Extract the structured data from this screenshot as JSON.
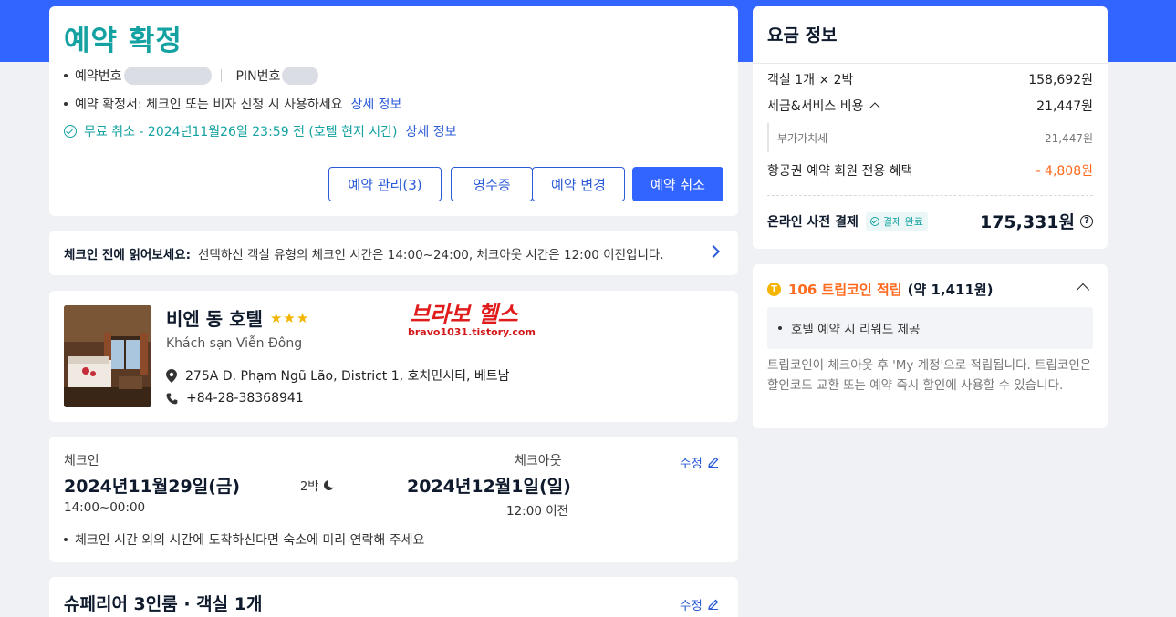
{
  "header": {
    "title": "예약 확정",
    "booking_number_label": "예약번호",
    "pin_label": "PIN번호",
    "confirmation_text": "예약 확정서: 체크인 또는 비자 신청 시 사용하세요",
    "confirmation_link": "상세 정보",
    "free_cancel_text": "무료 취소 - 2024년11월26일 23:59 전 (호텔 현지 시간)",
    "free_cancel_link": "상세 정보",
    "buttons": {
      "manage": "예약 관리(3)",
      "receipt": "영수증",
      "change": "예약 변경",
      "cancel": "예약 취소"
    }
  },
  "notice": {
    "label": "체크인 전에 읽어보세요:",
    "text": "선택하신 객실 유형의 체크인 시간은 14:00~24:00, 체크아웃 시간은 12:00 이전입니다."
  },
  "hotel": {
    "name": "비엔 동 호텔",
    "stars": "★★★",
    "star_count": 3,
    "local_name": "Khách sạn Viễn Đông",
    "address": "275A Đ. Phạm Ngũ Lão, District 1, 호치민시티, 베트남",
    "phone": "+84-28-38368941",
    "watermark_title": "브라보 헬스",
    "watermark_url": "bravo1031.tistory.com"
  },
  "stay": {
    "checkin_label": "체크인",
    "checkin_date": "2024년11월29일(금)",
    "checkin_time": "14:00~00:00",
    "nights": "2박",
    "checkout_label": "체크아웃",
    "checkout_date": "2024년12월1일(일)",
    "checkout_time": "12:00 이전",
    "edit_label": "수정",
    "note": "체크인 시간 외의 시간에 도착하신다면 숙소에 미리 연락해 주세요"
  },
  "room": {
    "title": "슈페리어 3인룸 · 객실 1개",
    "edit_label": "수정"
  },
  "price": {
    "title": "요금 정보",
    "rows": [
      {
        "label": "객실 1개 × 2박",
        "value": "158,692원"
      },
      {
        "label": "세금&서비스 비용",
        "value": "21,447원"
      },
      {
        "label": "부가가치세",
        "value": "21,447원"
      },
      {
        "label": "항공권 예약 회원 전용 혜택",
        "value": "- 4,808원"
      }
    ],
    "total_label": "온라인 사전 결제",
    "paid_badge": "결제 완료",
    "total_value": "175,331원",
    "accent_color": "#ff6a1f"
  },
  "coin": {
    "amount": "106 트립코인 적립",
    "approx": "(약 1,411원)",
    "reward_item": "호텔 예약 시 리워드 제공",
    "description": "트립코인이 체크아웃 후 'My 계정'으로 적립됩니다. 트립코인은 할인코드 교환 또는 예약 즉시 할인에 사용할 수 있습니다."
  },
  "colors": {
    "brand_blue": "#3264ff",
    "teal": "#13a1a1",
    "link_blue": "#2b5bd7",
    "coin_gold": "#f5b400"
  }
}
